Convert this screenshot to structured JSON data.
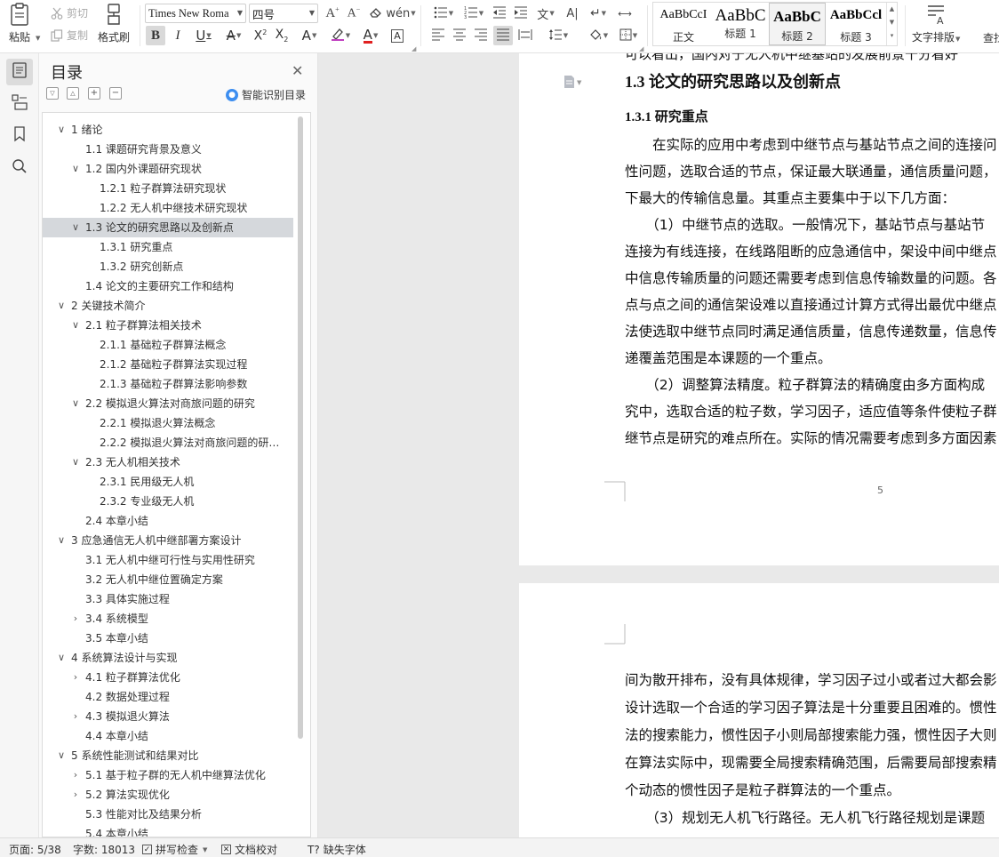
{
  "ribbon": {
    "paste": "粘贴",
    "cut": "剪切",
    "copy": "复制",
    "format_painter": "格式刷",
    "font_name": "Times New Roma",
    "font_size": "四号",
    "styles": [
      {
        "preview": "AaBbCcI",
        "name": "正文"
      },
      {
        "preview": "AaBbC",
        "name": "标题 1"
      },
      {
        "preview": "AaBbC",
        "name": "标题 2"
      },
      {
        "preview": "AaBbCcl",
        "name": "标题 3"
      }
    ],
    "text_layout": "文字排版",
    "find": "查找"
  },
  "toc": {
    "title": "目录",
    "smart_label": "智能识别目录",
    "items": [
      {
        "text": "1 绪论",
        "level": 1,
        "chevron": "down"
      },
      {
        "text": "1.1 课题研究背景及意义",
        "level": 2,
        "chevron": ""
      },
      {
        "text": "1.2 国内外课题研究现状",
        "level": 2,
        "chevron": "down"
      },
      {
        "text": "1.2.1 粒子群算法研究现状",
        "level": 3,
        "chevron": ""
      },
      {
        "text": "1.2.2 无人机中继技术研究现状",
        "level": 3,
        "chevron": ""
      },
      {
        "text": "1.3 论文的研究思路以及创新点",
        "level": 2,
        "chevron": "down",
        "selected": true
      },
      {
        "text": "1.3.1 研究重点",
        "level": 3,
        "chevron": ""
      },
      {
        "text": "1.3.2 研究创新点",
        "level": 3,
        "chevron": ""
      },
      {
        "text": "1.4 论文的主要研究工作和结构",
        "level": 2,
        "chevron": ""
      },
      {
        "text": "2 关键技术简介",
        "level": 1,
        "chevron": "down"
      },
      {
        "text": "2.1 粒子群算法相关技术",
        "level": 2,
        "chevron": "down"
      },
      {
        "text": "2.1.1 基础粒子群算法概念",
        "level": 3,
        "chevron": ""
      },
      {
        "text": "2.1.2 基础粒子群算法实现过程",
        "level": 3,
        "chevron": ""
      },
      {
        "text": "2.1.3 基础粒子群算法影响参数",
        "level": 3,
        "chevron": ""
      },
      {
        "text": "2.2 模拟退火算法对商旅问题的研究",
        "level": 2,
        "chevron": "down"
      },
      {
        "text": "2.2.1 模拟退火算法概念",
        "level": 3,
        "chevron": ""
      },
      {
        "text": "2.2.2 模拟退火算法对商旅问题的研究…",
        "level": 3,
        "chevron": ""
      },
      {
        "text": "2.3 无人机相关技术",
        "level": 2,
        "chevron": "down"
      },
      {
        "text": "2.3.1 民用级无人机",
        "level": 3,
        "chevron": ""
      },
      {
        "text": "2.3.2 专业级无人机",
        "level": 3,
        "chevron": ""
      },
      {
        "text": "2.4 本章小结",
        "level": 2,
        "chevron": ""
      },
      {
        "text": "3 应急通信无人机中继部署方案设计",
        "level": 1,
        "chevron": "down"
      },
      {
        "text": "3.1 无人机中继可行性与实用性研究",
        "level": 2,
        "chevron": ""
      },
      {
        "text": "3.2 无人机中继位置确定方案",
        "level": 2,
        "chevron": ""
      },
      {
        "text": "3.3 具体实施过程",
        "level": 2,
        "chevron": ""
      },
      {
        "text": "3.4 系统模型",
        "level": 2,
        "chevron": "right"
      },
      {
        "text": "3.5 本章小结",
        "level": 2,
        "chevron": ""
      },
      {
        "text": "4 系统算法设计与实现",
        "level": 1,
        "chevron": "down"
      },
      {
        "text": "4.1 粒子群算法优化",
        "level": 2,
        "chevron": "right"
      },
      {
        "text": "4.2 数据处理过程",
        "level": 2,
        "chevron": ""
      },
      {
        "text": "4.3 模拟退火算法",
        "level": 2,
        "chevron": "right"
      },
      {
        "text": "4.4 本章小结",
        "level": 2,
        "chevron": ""
      },
      {
        "text": "5 系统性能测试和结果对比",
        "level": 1,
        "chevron": "down"
      },
      {
        "text": "5.1 基于粒子群的无人机中继算法优化",
        "level": 2,
        "chevron": "right"
      },
      {
        "text": "5.2 算法实现优化",
        "level": 2,
        "chevron": "right"
      },
      {
        "text": "5.3 性能对比及结果分析",
        "level": 2,
        "chevron": ""
      },
      {
        "text": "5.4 本章小结",
        "level": 2,
        "chevron": ""
      }
    ]
  },
  "document": {
    "top_cut_text": "可以看出，国内对于无人机中继基站的发展前景十分看好",
    "heading": "1.3 论文的研究思路以及创新点",
    "subheading": "1.3.1 研究重点",
    "page1_lines": [
      "　　在实际的应用中考虑到中继节点与基站节点之间的连接问",
      "性问题，选取合适的节点，保证最大联通量，通信质量问题，",
      "下最大的传输信息量。其重点主要集中于以下几方面：",
      "　　（1）中继节点的选取。一般情况下，基站节点与基站节",
      "连接为有线连接，在线路阻断的应急通信中，架设中间中继点",
      "中信息传输质量的问题还需要考虑到信息传输数量的问题。各",
      "点与点之间的通信架设难以直接通过计算方式得出最优中继点",
      "法使选取中继节点同时满足通信质量，信息传递数量，信息传",
      "递覆盖范围是本课题的一个重点。",
      "　　（2）调整算法精度。粒子群算法的精确度由多方面构成",
      "究中，选取合适的粒子数，学习因子，适应值等条件使粒子群",
      "继节点是研究的难点所在。实际的情况需要考虑到多方面因素"
    ],
    "page_number": "5",
    "page2_lines": [
      "间为散开排布，没有具体规律，学习因子过小或者过大都会影",
      "设计选取一个合适的学习因子算法是十分重要且困难的。惯性",
      "法的搜索能力，惯性因子小则局部搜索能力强，惯性因子大则",
      "在算法实际中，现需要全局搜索精确范围，后需要局部搜索精",
      "个动态的惯性因子是粒子群算法的一个重点。",
      "　　（3）规划无人机飞行路径。无人机飞行路径规划是课题"
    ]
  },
  "status": {
    "page": "页面: 5/38",
    "words": "字数: 18013",
    "spell": "拼写检查",
    "proof": "文档校对",
    "missing_font": "缺失字体"
  },
  "colors": {
    "accent": "#3d8ef0",
    "font_red": "#e02020",
    "selected_row": "#d5d8dc"
  }
}
